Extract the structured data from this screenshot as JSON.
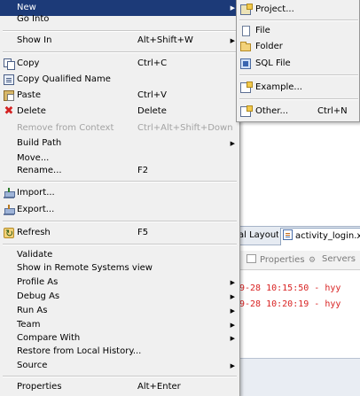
{
  "context_menu": {
    "items": [
      {
        "label": "New",
        "shortcut": "",
        "arrow": "▶",
        "icon": "",
        "state": "highlighted"
      },
      {
        "label": "Go Into",
        "shortcut": "",
        "arrow": "",
        "icon": "",
        "state": "enabled"
      },
      {
        "label": "Show In",
        "shortcut": "Alt+Shift+W",
        "arrow": "▶",
        "icon": "",
        "state": "enabled"
      },
      {
        "label": "Copy",
        "shortcut": "Ctrl+C",
        "arrow": "",
        "icon": "copy-icon",
        "state": "enabled"
      },
      {
        "label": "Copy Qualified Name",
        "shortcut": "",
        "arrow": "",
        "icon": "copy-qualified-name-icon",
        "state": "enabled"
      },
      {
        "label": "Paste",
        "shortcut": "Ctrl+V",
        "arrow": "",
        "icon": "paste-icon",
        "state": "enabled"
      },
      {
        "label": "Delete",
        "shortcut": "Delete",
        "arrow": "",
        "icon": "delete-icon",
        "state": "enabled"
      },
      {
        "label": "Remove from Context",
        "shortcut": "Ctrl+Alt+Shift+Down",
        "arrow": "",
        "icon": "",
        "state": "disabled"
      },
      {
        "label": "Build Path",
        "shortcut": "",
        "arrow": "▶",
        "icon": "",
        "state": "enabled"
      },
      {
        "label": "Move...",
        "shortcut": "",
        "arrow": "",
        "icon": "",
        "state": "enabled"
      },
      {
        "label": "Rename...",
        "shortcut": "F2",
        "arrow": "",
        "icon": "",
        "state": "enabled"
      },
      {
        "label": "Import...",
        "shortcut": "",
        "arrow": "",
        "icon": "import-icon",
        "state": "enabled"
      },
      {
        "label": "Export...",
        "shortcut": "",
        "arrow": "",
        "icon": "export-icon",
        "state": "enabled"
      },
      {
        "label": "Refresh",
        "shortcut": "F5",
        "arrow": "",
        "icon": "refresh-icon",
        "state": "enabled"
      },
      {
        "label": "Validate",
        "shortcut": "",
        "arrow": "",
        "icon": "",
        "state": "enabled"
      },
      {
        "label": "Show in Remote Systems view",
        "shortcut": "",
        "arrow": "",
        "icon": "",
        "state": "enabled"
      },
      {
        "label": "Profile As",
        "shortcut": "",
        "arrow": "▶",
        "icon": "",
        "state": "enabled"
      },
      {
        "label": "Debug As",
        "shortcut": "",
        "arrow": "▶",
        "icon": "",
        "state": "enabled"
      },
      {
        "label": "Run As",
        "shortcut": "",
        "arrow": "▶",
        "icon": "",
        "state": "enabled"
      },
      {
        "label": "Team",
        "shortcut": "",
        "arrow": "▶",
        "icon": "",
        "state": "enabled"
      },
      {
        "label": "Compare With",
        "shortcut": "",
        "arrow": "▶",
        "icon": "",
        "state": "enabled"
      },
      {
        "label": "Restore from Local History...",
        "shortcut": "",
        "arrow": "",
        "icon": "",
        "state": "enabled"
      },
      {
        "label": "Source",
        "shortcut": "",
        "arrow": "▶",
        "icon": "",
        "state": "enabled"
      },
      {
        "label": "Properties",
        "shortcut": "Alt+Enter",
        "arrow": "",
        "icon": "",
        "state": "enabled"
      }
    ]
  },
  "new_submenu": {
    "items": [
      {
        "label": "Project...",
        "shortcut": "",
        "icon": "project-icon"
      },
      {
        "label": "File",
        "shortcut": "",
        "icon": "file-icon"
      },
      {
        "label": "Folder",
        "shortcut": "",
        "icon": "folder-icon"
      },
      {
        "label": "SQL File",
        "shortcut": "",
        "icon": "sql-file-icon"
      },
      {
        "label": "Example...",
        "shortcut": "",
        "icon": "example-icon"
      },
      {
        "label": "Other...",
        "shortcut": "Ctrl+N",
        "icon": "other-wizard-icon"
      }
    ]
  },
  "background": {
    "editor_tabs": {
      "layout_tab": "al Layout",
      "file_tab": "activity_login.xml"
    },
    "view_tabs": {
      "properties": "Properties",
      "servers": "Servers"
    },
    "console_lines": [
      "9-28 10:15:50 - hyy",
      "9-28 10:20:19 - hyy"
    ]
  },
  "colors": {
    "highlight": "#1c3a78",
    "log_red": "#d92323",
    "menu_bg": "#f0f0f0"
  }
}
